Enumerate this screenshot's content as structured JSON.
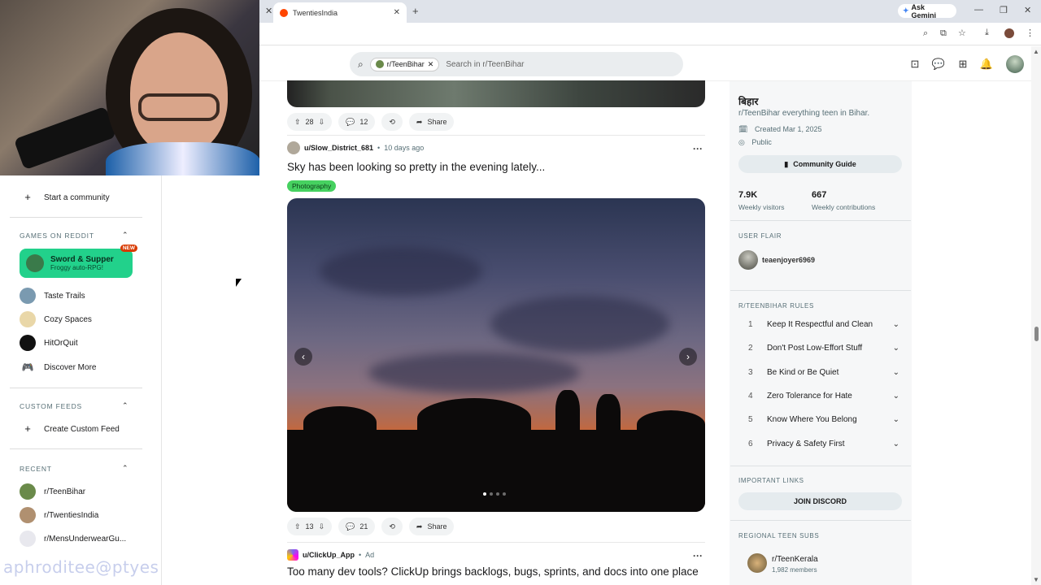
{
  "browser": {
    "tab_title": "TwentiesIndia",
    "ask_gemini": "Ask Gemini"
  },
  "header": {
    "search_chip": "r/TeenBihar",
    "search_placeholder": "Search in r/TeenBihar"
  },
  "left_nav": {
    "start_community": "Start a community",
    "games_section": "GAMES ON REDDIT",
    "games": [
      {
        "title": "Sword & Supper",
        "subtitle": "Froggy auto-RPG!",
        "badge": "NEW"
      },
      {
        "title": "Taste Trails"
      },
      {
        "title": "Cozy Spaces"
      },
      {
        "title": "HitOrQuit"
      },
      {
        "title": "Discover More"
      }
    ],
    "custom_feeds_section": "CUSTOM FEEDS",
    "create_custom_feed": "Create Custom Feed",
    "recent_section": "RECENT",
    "recent": [
      "r/TeenBihar",
      "r/TwentiesIndia",
      "r/MensUnderwearGu..."
    ]
  },
  "watermark": "aphroditee@ptyes",
  "posts": [
    {
      "upvotes": "28",
      "comments": "12",
      "share": "Share"
    },
    {
      "user": "u/Slow_District_681",
      "age": "10 days ago",
      "title": "Sky has been looking so pretty in the evening lately...",
      "flair": "Photography",
      "upvotes": "13",
      "comments": "21",
      "share": "Share"
    },
    {
      "user": "u/ClickUp_App",
      "age": "Ad",
      "title": "Too many dev tools? ClickUp brings backlogs, bugs, sprints, and docs into one place"
    }
  ],
  "sidebar": {
    "name": "बिहार",
    "description": "r/TeenBihar everything teen in Bihar.",
    "created": "Created Mar 1, 2025",
    "visibility": "Public",
    "guide_button": "Community Guide",
    "stats": [
      {
        "value": "7.9K",
        "label": "Weekly visitors"
      },
      {
        "value": "667",
        "label": "Weekly contributions"
      }
    ],
    "user_flair_head": "USER FLAIR",
    "user_flair": "teaenjoyer6969",
    "rules_head": "R/TEENBIHAR RULES",
    "rules": [
      {
        "n": "1",
        "text": "Keep It Respectful and Clean"
      },
      {
        "n": "2",
        "text": "Don't Post Low-Effort Stuff"
      },
      {
        "n": "3",
        "text": "Be Kind or Be Quiet"
      },
      {
        "n": "4",
        "text": "Zero Tolerance for Hate"
      },
      {
        "n": "5",
        "text": "Know Where You Belong"
      },
      {
        "n": "6",
        "text": "Privacy & Safety First"
      }
    ],
    "links_head": "IMPORTANT LINKS",
    "join_discord": "JOIN DISCORD",
    "regional_head": "REGIONAL TEEN SUBS",
    "regional": [
      {
        "name": "r/TeenKerala",
        "members": "1,982 members"
      }
    ]
  }
}
